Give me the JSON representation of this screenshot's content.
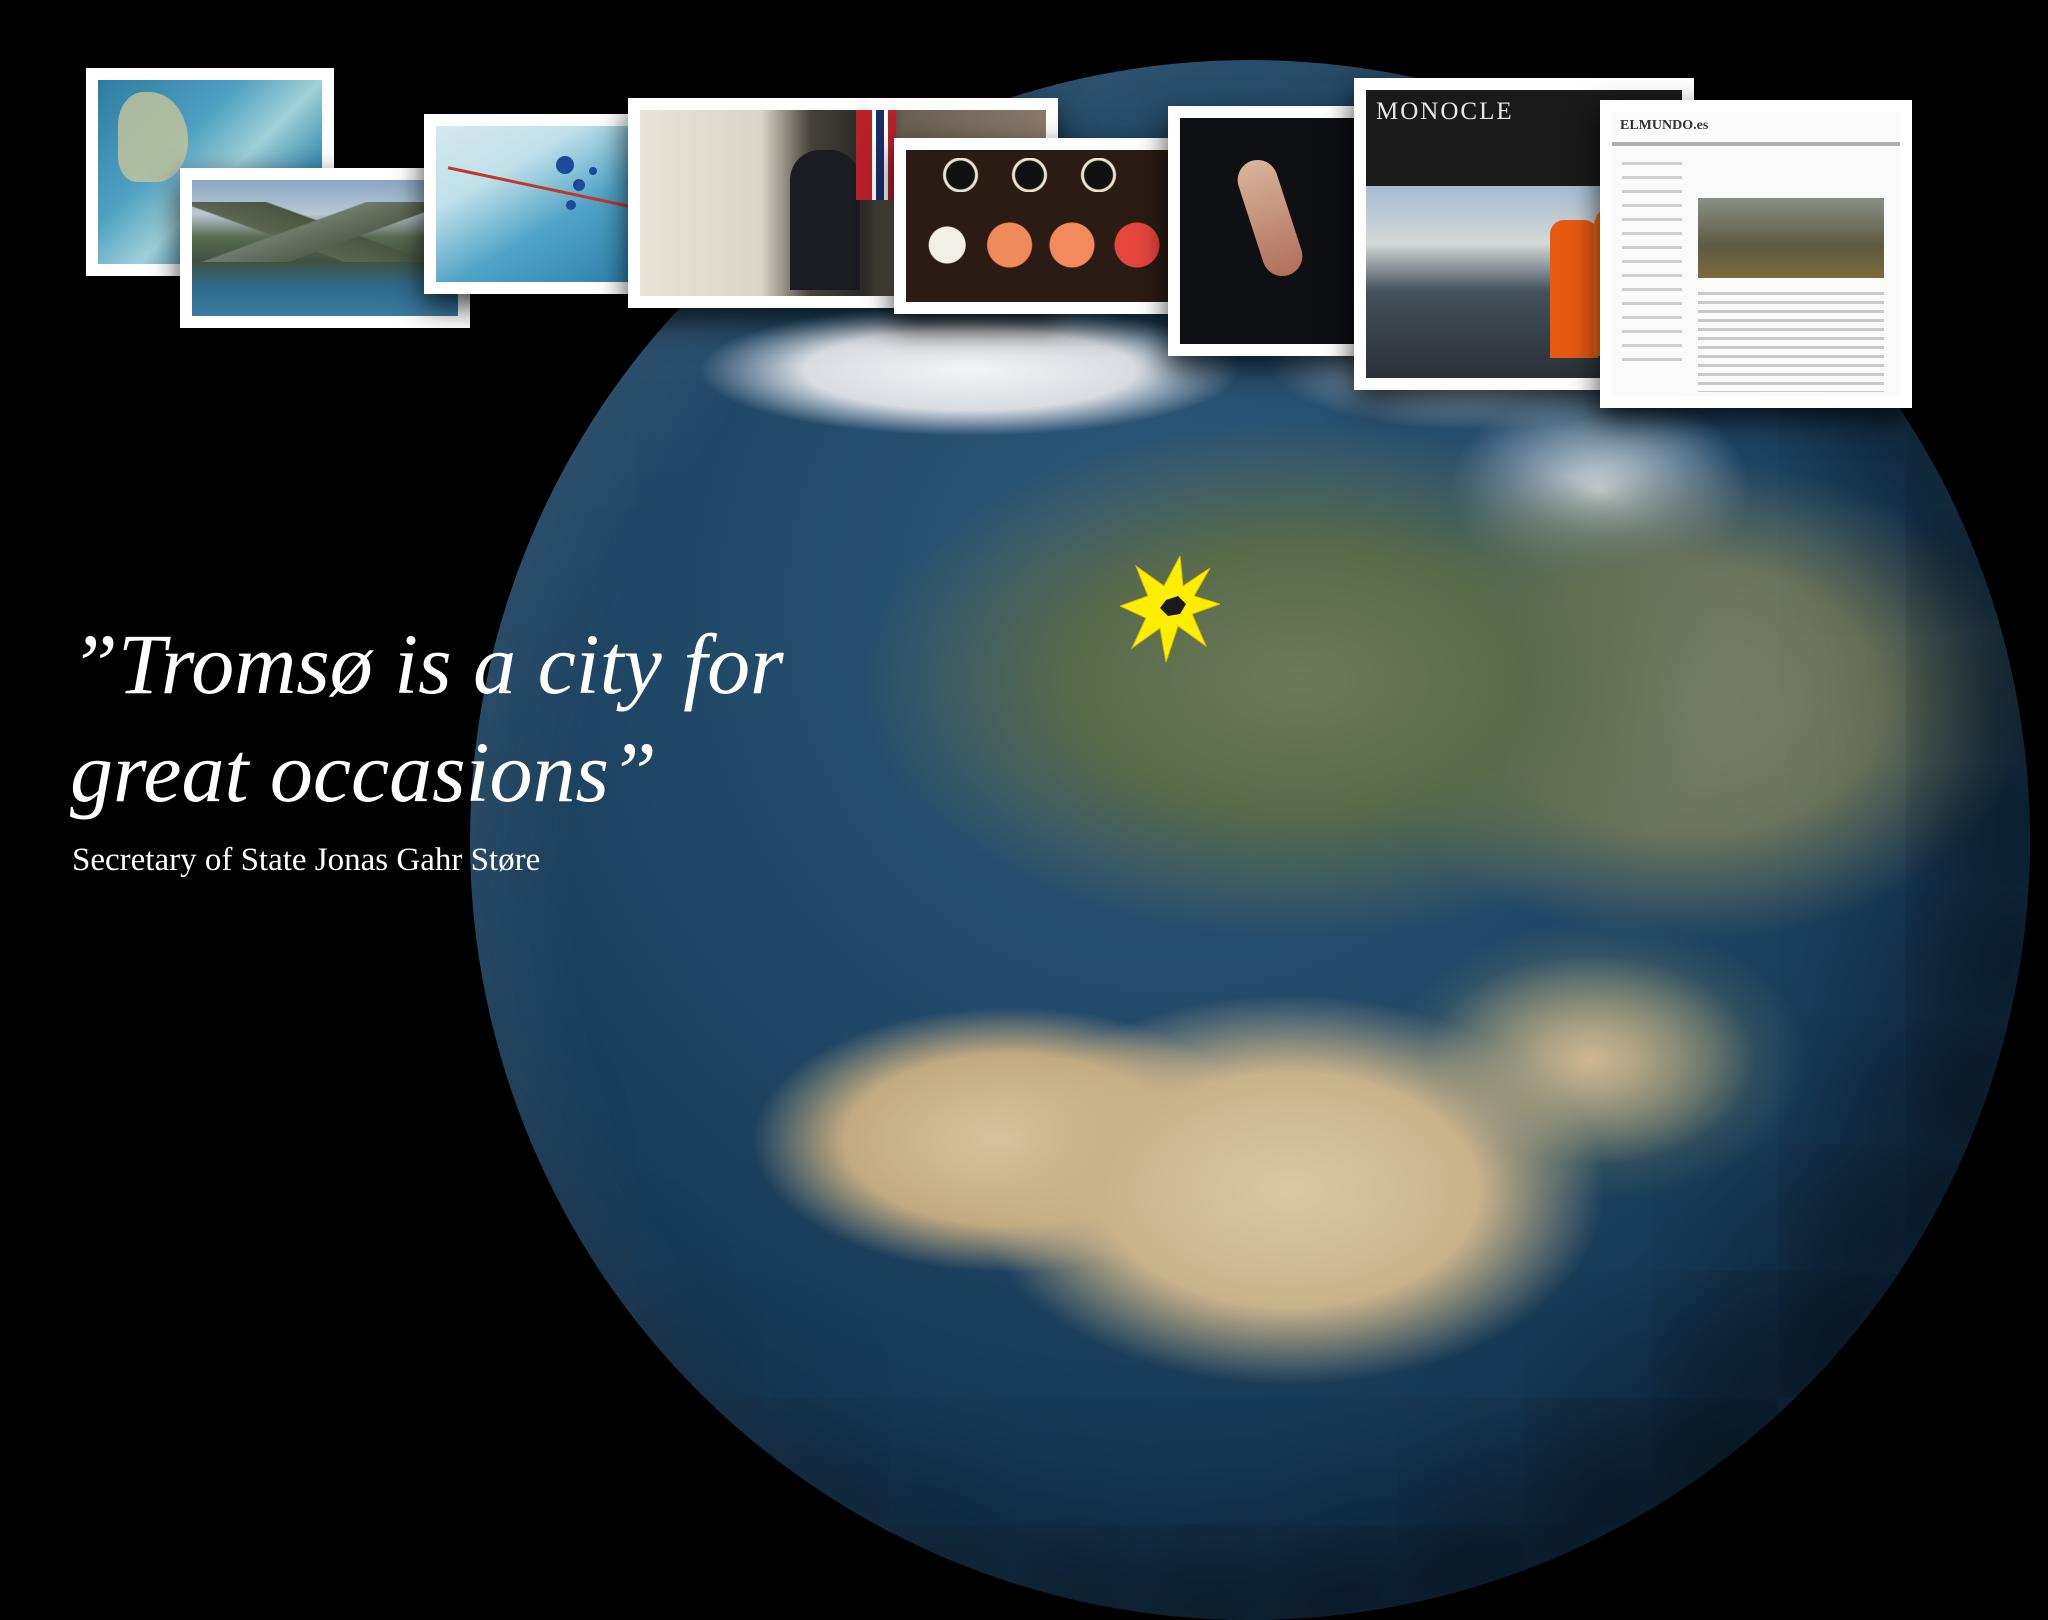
{
  "slide": {
    "quote_line1": "”Tromsø is a city for",
    "quote_line2": "great occasions”",
    "attribution": "Secretary of State Jonas Gahr Støre"
  },
  "clippings": {
    "monocle_masthead": "MONOCLE",
    "elmundo_masthead": "ELMUNDO.es"
  },
  "colors": {
    "background": "#000000",
    "text": "#ffffff",
    "marker": "#ffee00"
  },
  "icons": {
    "marker": "starburst-icon"
  }
}
